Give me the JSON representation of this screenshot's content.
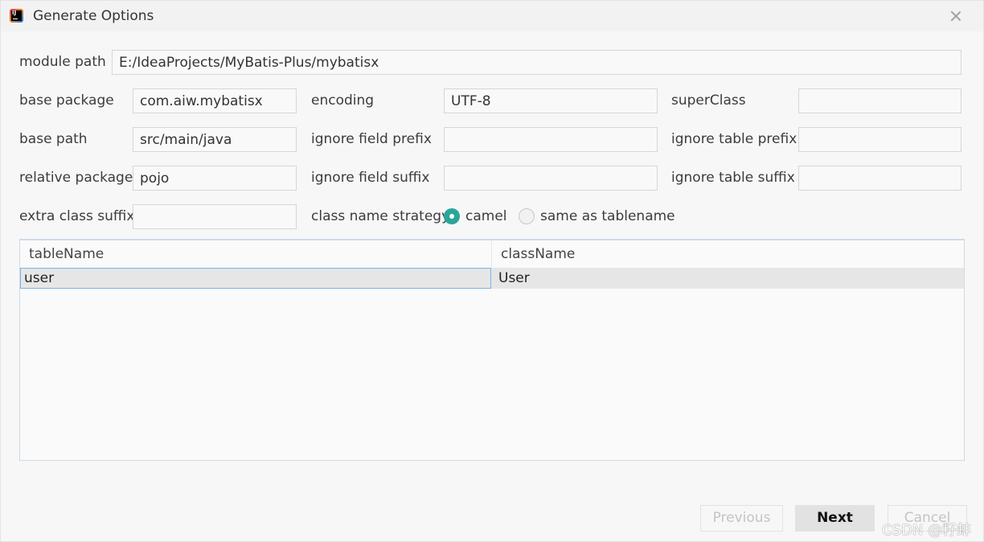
{
  "window": {
    "title": "Generate Options"
  },
  "form": {
    "module_path": {
      "label": "module path",
      "value": "E:/IdeaProjects/MyBatis-Plus/mybatisx"
    },
    "base_package": {
      "label": "base package",
      "value": "com.aiw.mybatisx"
    },
    "encoding": {
      "label": "encoding",
      "value": "UTF-8"
    },
    "super_class": {
      "label": "superClass",
      "value": ""
    },
    "base_path": {
      "label": "base path",
      "value": "src/main/java"
    },
    "ignore_field_prefix": {
      "label": "ignore field prefix",
      "value": ""
    },
    "ignore_table_prefix": {
      "label": "ignore table prefix",
      "value": ""
    },
    "relative_package": {
      "label": "relative package",
      "value": "pojo"
    },
    "ignore_field_suffix": {
      "label": "ignore field suffix",
      "value": ""
    },
    "ignore_table_suffix": {
      "label": "ignore table suffix",
      "value": ""
    },
    "extra_class_suffix": {
      "label": "extra class suffix",
      "value": ""
    },
    "class_name_strategy": {
      "label": "class name strategy",
      "options": [
        {
          "label": "camel",
          "selected": true
        },
        {
          "label": "same as tablename",
          "selected": false
        }
      ]
    }
  },
  "table": {
    "columns": [
      "tableName",
      "className"
    ],
    "rows": [
      {
        "tableName": "user",
        "className": "User"
      }
    ]
  },
  "buttons": {
    "previous": "Previous",
    "next": "Next",
    "cancel": "Cancel"
  },
  "watermark": "CSDN @籽蚌",
  "colors": {
    "accent": "#2aa59a",
    "selection_border": "#7ab4e6",
    "row_highlight": "#e6e6e6"
  }
}
